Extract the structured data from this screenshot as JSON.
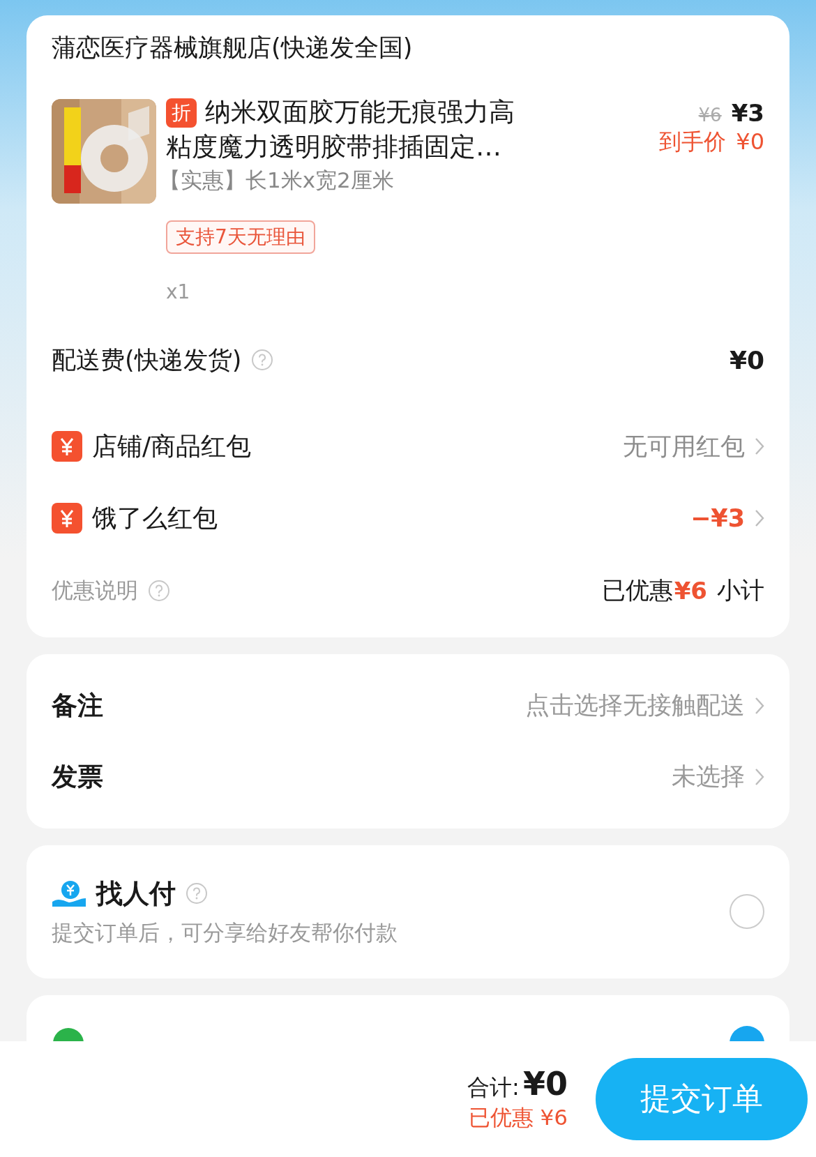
{
  "store": {
    "name": "蒲恋医疗器械旗舰店(快递发全国)"
  },
  "product": {
    "badge": "折",
    "title": "纳米双面胶万能无痕强力高粘度魔力透明胶带排插固定…",
    "spec": "【实惠】长1米x宽2厘米",
    "tag": "支持7天无理由",
    "quantity": "x1",
    "original_price": "¥6",
    "price": "¥3",
    "final_label": "到手价",
    "final_price": "¥0"
  },
  "delivery": {
    "label": "配送费(快递发货)",
    "value": "¥0"
  },
  "coupons": [
    {
      "label": "店铺/商品红包",
      "value": "无可用红包",
      "kind": "muted"
    },
    {
      "label": "饿了么红包",
      "value": "−¥3",
      "kind": "discount"
    }
  ],
  "summary": {
    "note": "优惠说明",
    "saved_label": "已优惠",
    "saved_value": "¥6",
    "subtotal_label": "小计"
  },
  "options": [
    {
      "label": "备注",
      "value": "点击选择无接触配送"
    },
    {
      "label": "发票",
      "value": "未选择"
    }
  ],
  "pay_for_me": {
    "title": "找人付",
    "description": "提交订单后，可分享给好友帮你付款",
    "selected": false
  },
  "payment": {
    "selected": true
  },
  "footer": {
    "total_label": "合计:",
    "total_value": "¥0",
    "saved": "已优惠 ¥6",
    "submit": "提交订单"
  }
}
